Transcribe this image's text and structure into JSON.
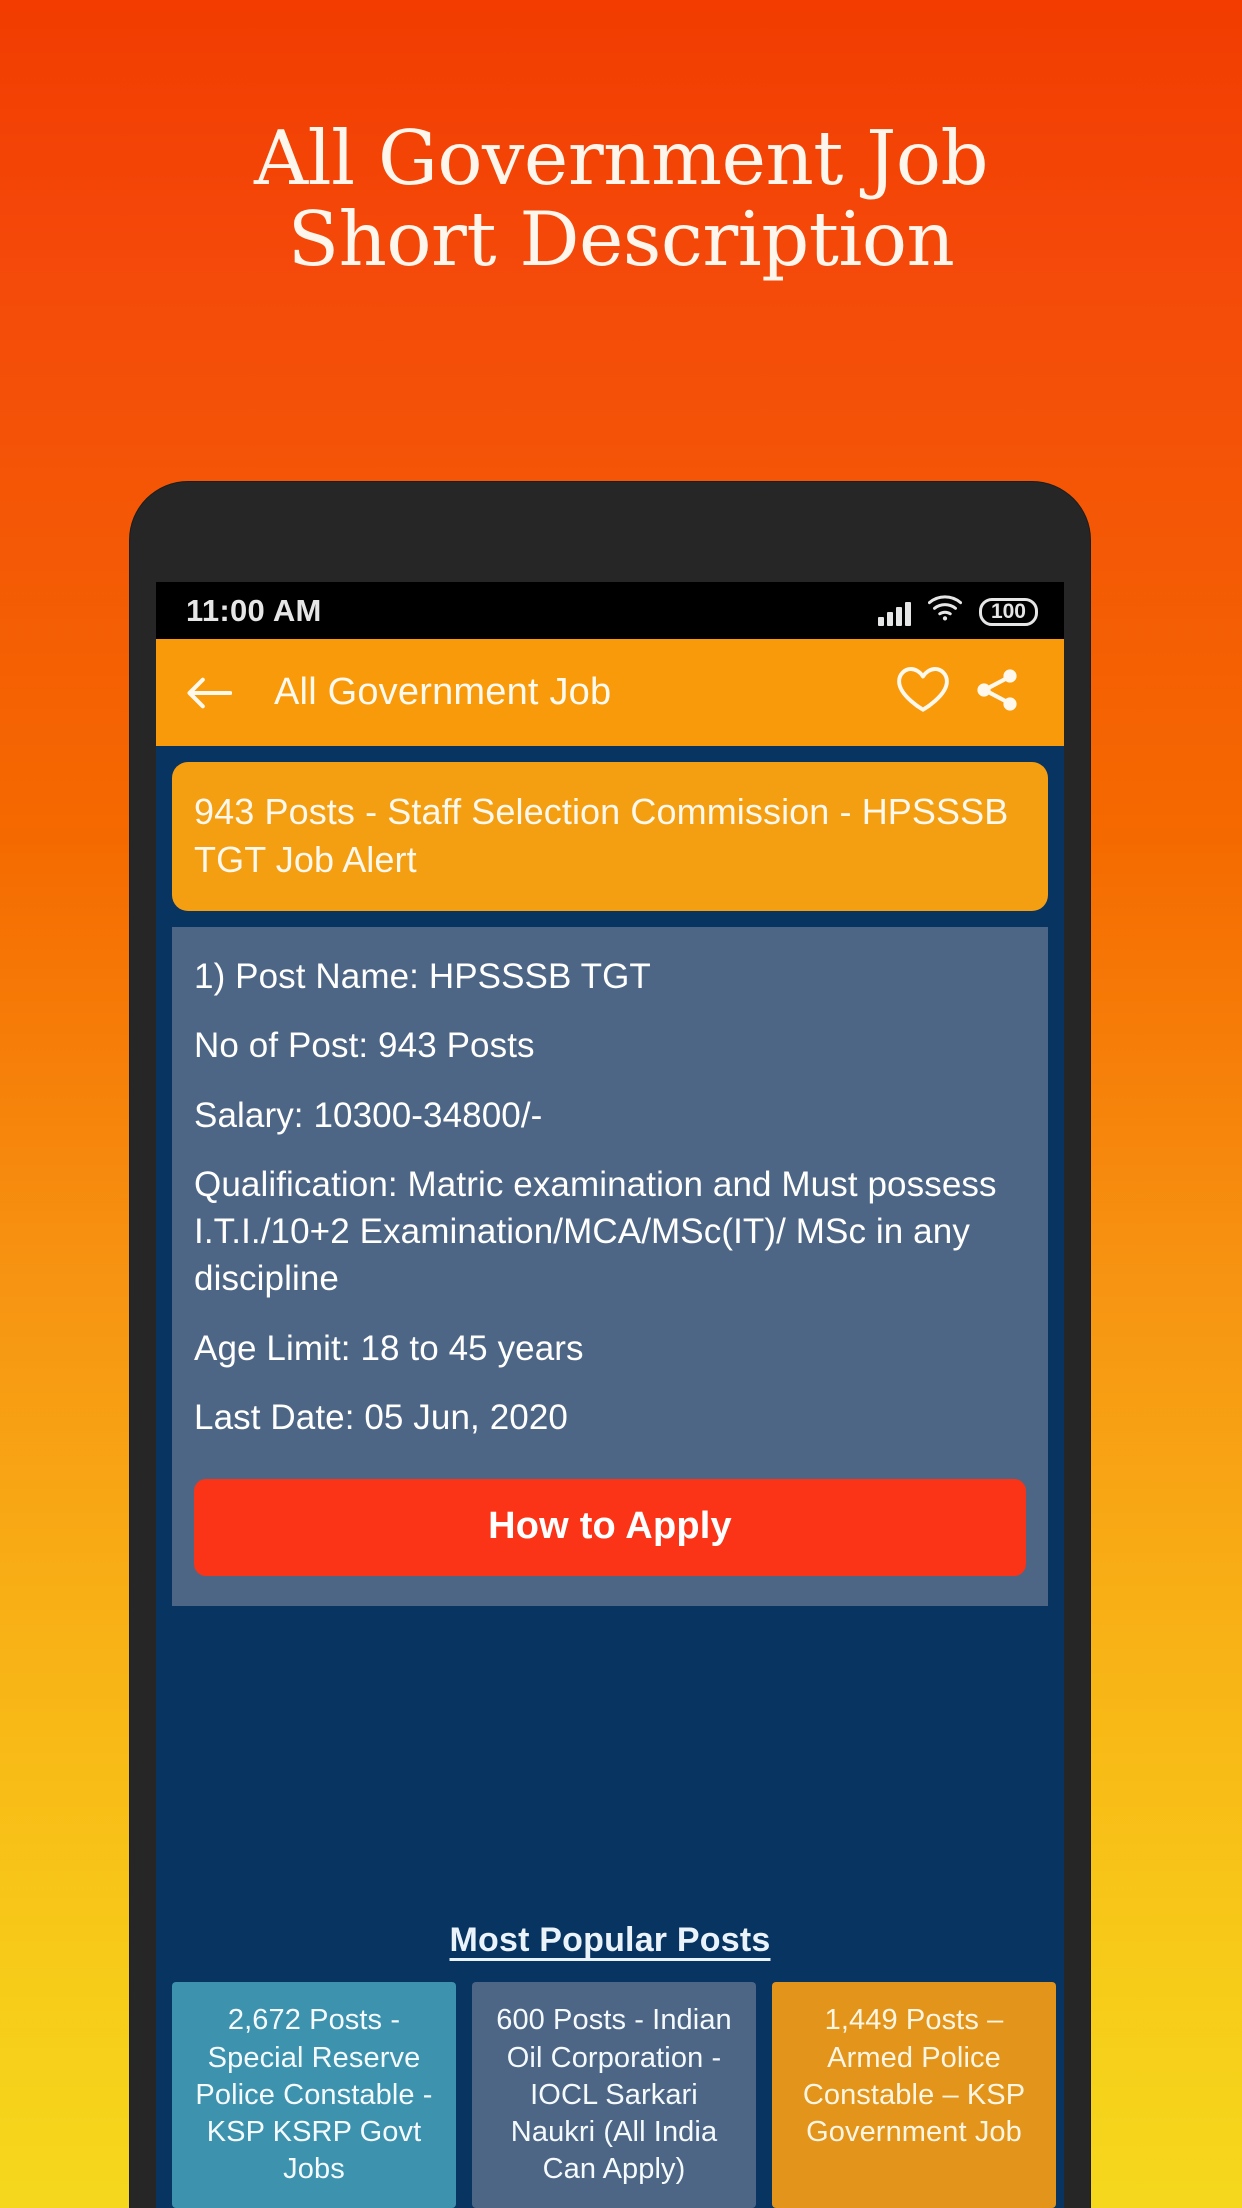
{
  "promo": {
    "line1": "All Government Job",
    "line2": "Short Description"
  },
  "colors": {
    "bg_top": "#F23C00",
    "bg_bottom": "#F5D81D",
    "appbar": "#F89A09",
    "screen_bg": "#083462",
    "title_card": "#F49E12",
    "detail_card": "#4E6685",
    "apply_button": "#FB3417",
    "popular_card_1": "#3D92AE",
    "popular_card_2": "#4E6685",
    "popular_card_3": "#E3941B"
  },
  "statusbar": {
    "time": "11:00 AM",
    "signal_icon": "signal-bars-icon",
    "wifi_icon": "wifi-icon",
    "battery_level": "100"
  },
  "appbar": {
    "back_icon": "back-arrow-icon",
    "title": "All Government Job",
    "favorite_icon": "heart-outline-icon",
    "share_icon": "share-icon"
  },
  "job": {
    "headline": "943 Posts - Staff Selection Commission - HPSSSB TGT Job Alert",
    "lines": [
      "1) Post Name: HPSSSB TGT",
      "No of Post: 943 Posts",
      "Salary: 10300-34800/-",
      "Qualification: Matric examination and Must possess I.T.I./10+2 Examination/MCA/MSc(IT)/ MSc in any discipline",
      "Age Limit: 18 to 45 years",
      "Last Date: 05 Jun, 2020"
    ],
    "apply_label": "How to Apply"
  },
  "popular": {
    "heading": "Most Popular Posts",
    "cards": [
      {
        "text": "2,672 Posts - Special Reserve Police Constable - KSP KSRP Govt Jobs"
      },
      {
        "text": "600 Posts - Indian Oil Corporation - IOCL Sarkari Naukri (All India Can Apply)"
      },
      {
        "text": "1,449 Posts – Armed Police Constable – KSP Government Job"
      }
    ]
  }
}
